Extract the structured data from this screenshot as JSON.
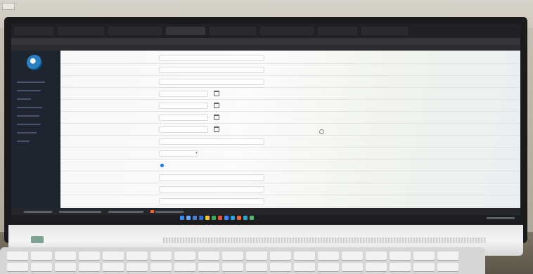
{
  "browser": {
    "tabs": [
      {
        "label": "",
        "active": false
      },
      {
        "label": "",
        "active": false
      },
      {
        "label": "",
        "active": false
      },
      {
        "label": "",
        "active": true
      },
      {
        "label": "",
        "active": false
      },
      {
        "label": "",
        "active": false
      },
      {
        "label": "",
        "active": false
      },
      {
        "label": "",
        "active": false
      }
    ],
    "url": "",
    "bookmarks": [
      "",
      "",
      ""
    ]
  },
  "form": {
    "rows": [
      {
        "label": "",
        "kind": "text"
      },
      {
        "label": "",
        "kind": "text"
      },
      {
        "label": "",
        "kind": "text"
      },
      {
        "label": "",
        "kind": "date"
      },
      {
        "label": "",
        "kind": "date"
      },
      {
        "label": "",
        "kind": "date"
      },
      {
        "label": "",
        "kind": "date"
      },
      {
        "label": "",
        "kind": "text"
      },
      {
        "label": "",
        "kind": "select"
      },
      {
        "label": "",
        "kind": "radio"
      },
      {
        "label": "",
        "kind": "text"
      },
      {
        "label": "",
        "kind": "text"
      },
      {
        "label": "",
        "kind": "text"
      }
    ]
  },
  "colors": {
    "sidebar": "#1e2430",
    "accent": "#1a73e8",
    "taskbar": "#1c1e22"
  }
}
